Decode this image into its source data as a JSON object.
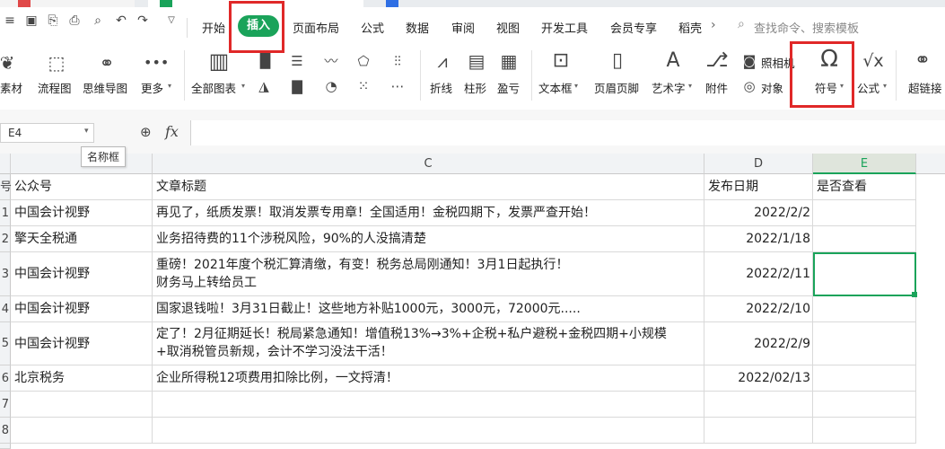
{
  "menu": {
    "tabs": [
      "开始",
      "插入",
      "页面布局",
      "公式",
      "数据",
      "审阅",
      "视图",
      "开发工具",
      "会员专享",
      "稻壳"
    ],
    "search_placeholder": "查找命令、搜索模板",
    "more_arrow": "›"
  },
  "ribbon": {
    "items": [
      {
        "label": "素材"
      },
      {
        "label": "流程图"
      },
      {
        "label": "思维导图"
      },
      {
        "label": "更多"
      },
      {
        "label": "全部图表"
      },
      {
        "label": "折线"
      },
      {
        "label": "柱形"
      },
      {
        "label": "盈亏"
      },
      {
        "label": "文本框"
      },
      {
        "label": "页眉页脚"
      },
      {
        "label": "艺术字"
      },
      {
        "label": "附件"
      },
      {
        "label": "照相机"
      },
      {
        "label": "对象"
      },
      {
        "label": "符号"
      },
      {
        "label": "公式"
      },
      {
        "label": "超链接"
      }
    ]
  },
  "formula_bar": {
    "name_box": "E4",
    "fx": "fx",
    "tooltip": "名称框"
  },
  "sheet": {
    "column_headers": [
      "C",
      "D",
      "E"
    ],
    "header_row": {
      "col_b": "公众号",
      "col_c": "文章标题",
      "col_d": "发布日期",
      "col_e": "是否查看",
      "row_num": "号"
    },
    "rows": [
      {
        "row": "1",
        "account": "中国会计视野",
        "title": [
          "再见了，纸质发票！取消发票专用章！全国适用！金税四期下，发票严查开始！"
        ],
        "date": "2022/2/2"
      },
      {
        "row": "2",
        "account": "擎天全税通",
        "title": [
          "业务招待费的11个涉税风险，90%的人没搞清楚"
        ],
        "date": "2022/1/18"
      },
      {
        "row": "3",
        "account": "中国会计视野",
        "title": [
          "重磅！2021年度个税汇算清缴，有变！税务总局刚通知！3月1日起执行！",
          "财务马上转给员工"
        ],
        "date": "2022/2/11"
      },
      {
        "row": "4",
        "account": "中国会计视野",
        "title": [
          "国家退钱啦！3月31日截止！这些地方补贴1000元，3000元，72000元....."
        ],
        "date": "2022/2/10"
      },
      {
        "row": "5",
        "account": "中国会计视野",
        "title": [
          "定了！2月征期延长！税局紧急通知！增值税13%→3%+企税+私户避税+金税四期+小规模",
          "+取消税管员新规，会计不学习没法干活！"
        ],
        "date": "2022/2/9"
      },
      {
        "row": "6",
        "account": "北京税务",
        "title": [
          "企业所得税12项费用扣除比例，一文捋清！"
        ],
        "date": "2022/02/13"
      },
      {
        "row": "7",
        "account": "",
        "title": [
          ""
        ],
        "date": ""
      },
      {
        "row": "8",
        "account": "",
        "title": [
          ""
        ],
        "date": ""
      }
    ]
  },
  "colors": {
    "accent_green": "#1aa35a",
    "highlight_red": "#e02828"
  }
}
